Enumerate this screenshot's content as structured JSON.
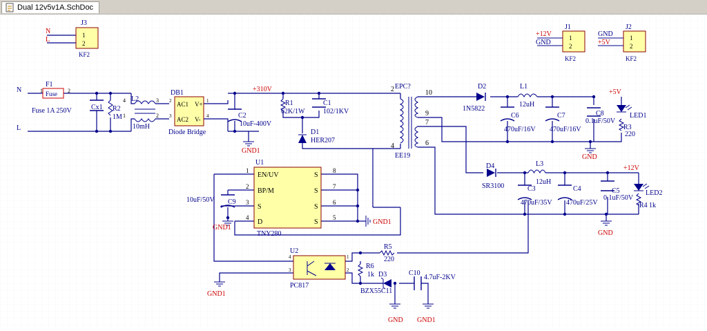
{
  "tab": {
    "title": "Dual 12v5v1A.SchDoc",
    "icon": "schematic-document-icon"
  },
  "colors": {
    "wire": "#00008b",
    "text": "#00008b",
    "red": "#cc0000",
    "body": "#ffffa8",
    "bodyStroke": "#8b0000",
    "pin": "#000000"
  },
  "nets": {
    "n": "N",
    "l": "L",
    "plus310": "+310V",
    "plus5": "+5V",
    "plus12": "+12V",
    "gnd": "GND",
    "gnd1": "GND1",
    "epc": "EPC?"
  },
  "connectors": {
    "j3": {
      "ref": "J3",
      "type": "KF2",
      "pins": [
        "1",
        "2"
      ],
      "nets": [
        "N",
        "L"
      ]
    },
    "j1": {
      "ref": "J1",
      "type": "KF2",
      "pins": [
        "1",
        "2"
      ],
      "nets": [
        "+12V",
        "GND"
      ]
    },
    "j2": {
      "ref": "J2",
      "type": "KF2",
      "pins": [
        "1",
        "2"
      ],
      "nets": [
        "GND",
        "+5V"
      ]
    }
  },
  "parts": {
    "f1": {
      "ref": "F1",
      "value": "Fuse",
      "desc": "Fuse 1A 250V",
      "pin1": "1",
      "pin2": "2"
    },
    "cx1": {
      "ref": "Cx1"
    },
    "r2": {
      "ref": "R2",
      "value": "1M"
    },
    "l2": {
      "ref": "L2",
      "value": "10mH",
      "pins": [
        "4",
        "3",
        "1",
        "2"
      ]
    },
    "db1": {
      "ref": "DB1",
      "value": "Diode Bridge",
      "pins": [
        "AC1",
        "AC2",
        "V+",
        "V-"
      ],
      "pinNums": [
        "2",
        "3",
        "1",
        "4"
      ]
    },
    "c2": {
      "ref": "C2",
      "value": "10uF-400V"
    },
    "r1": {
      "ref": "R1",
      "value": "62K/1W"
    },
    "c1": {
      "ref": "C1",
      "value": "102/1KV"
    },
    "d1": {
      "ref": "D1",
      "value": "HER207"
    },
    "t1": {
      "ref": "EE19",
      "pins": [
        "2",
        "4",
        "10",
        "9",
        "7",
        "6"
      ]
    },
    "d2": {
      "ref": "D2",
      "value": "1N5822"
    },
    "l1": {
      "ref": "L1",
      "value": "12uH"
    },
    "c6": {
      "ref": "C6",
      "value": "470uF/16V"
    },
    "c7": {
      "ref": "C7",
      "value": "470uF/16V"
    },
    "c8": {
      "ref": "C8",
      "value": "0.1uF/50V"
    },
    "led1": {
      "ref": "LED1"
    },
    "r3": {
      "ref": "R3",
      "value": "220"
    },
    "d4": {
      "ref": "D4",
      "value": "SR3100"
    },
    "l3": {
      "ref": "L3",
      "value": "12uH"
    },
    "c3": {
      "ref": "C3",
      "value": "470uF/35V"
    },
    "c4": {
      "ref": "C4",
      "value": "470uF/25V"
    },
    "c5": {
      "ref": "C5",
      "value": "0.1uF/50V"
    },
    "led2": {
      "ref": "LED2"
    },
    "r4": {
      "ref": "R4",
      "value": "1k"
    },
    "u1": {
      "ref": "U1",
      "value": "TNY280",
      "leftPins": [
        "EN/UV",
        "BP/M",
        "S",
        "D"
      ],
      "leftNums": [
        "1",
        "2",
        "3",
        "4"
      ],
      "rightPins": [
        "S",
        "S",
        "S",
        "S"
      ],
      "rightNums": [
        "8",
        "7",
        "6",
        "5"
      ]
    },
    "c9": {
      "ref": "C9",
      "value": "10uF/50V"
    },
    "u2": {
      "ref": "U2",
      "value": "PC817",
      "pins": [
        "4",
        "3",
        "1",
        "2"
      ]
    },
    "r5": {
      "ref": "R5",
      "value": "220"
    },
    "r6": {
      "ref": "R6",
      "value": "1k"
    },
    "d3": {
      "ref": "D3",
      "value": "BZX55C11"
    },
    "c10": {
      "ref": "C10",
      "value": "4.7uF-2KV"
    }
  }
}
